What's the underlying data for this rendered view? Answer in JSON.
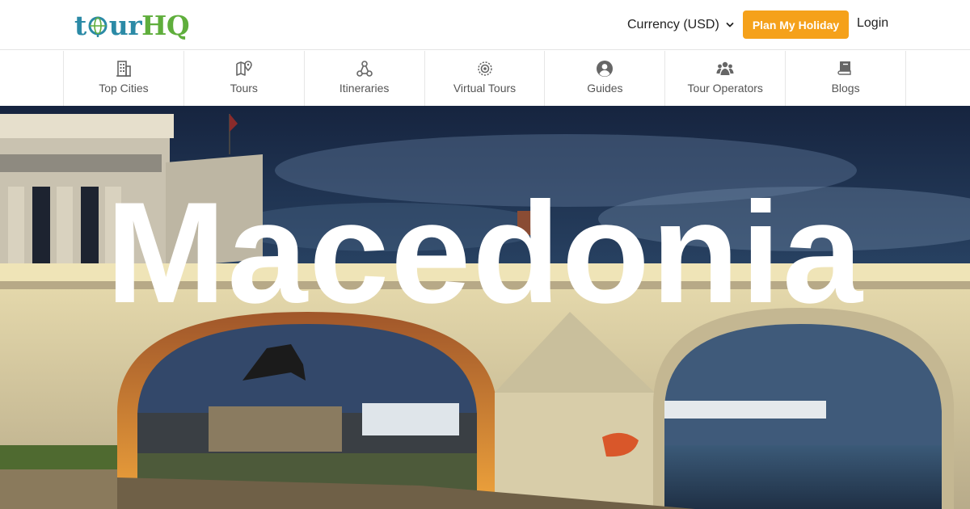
{
  "header": {
    "logo": {
      "part1": "t",
      "part2": "ur",
      "part3": "HQ"
    },
    "currency_label": "Currency (USD)",
    "plan_button": "Plan My Holiday",
    "login": "Login"
  },
  "nav": {
    "items": [
      {
        "label": "Top Cities",
        "icon": "building-icon"
      },
      {
        "label": "Tours",
        "icon": "map-pin-icon"
      },
      {
        "label": "Itineraries",
        "icon": "route-nodes-icon"
      },
      {
        "label": "Virtual Tours",
        "icon": "virtual-tour-icon"
      },
      {
        "label": "Guides",
        "icon": "user-circle-icon"
      },
      {
        "label": "Tour Operators",
        "icon": "group-icon"
      },
      {
        "label": "Blogs",
        "icon": "book-icon"
      }
    ]
  },
  "hero": {
    "title": "Macedonia"
  },
  "colors": {
    "accent": "#f5a11a",
    "logo_blue": "#2b8aa6",
    "logo_green": "#5fae3c",
    "sky": "#1d3557",
    "stone": "#cfc3a3"
  }
}
